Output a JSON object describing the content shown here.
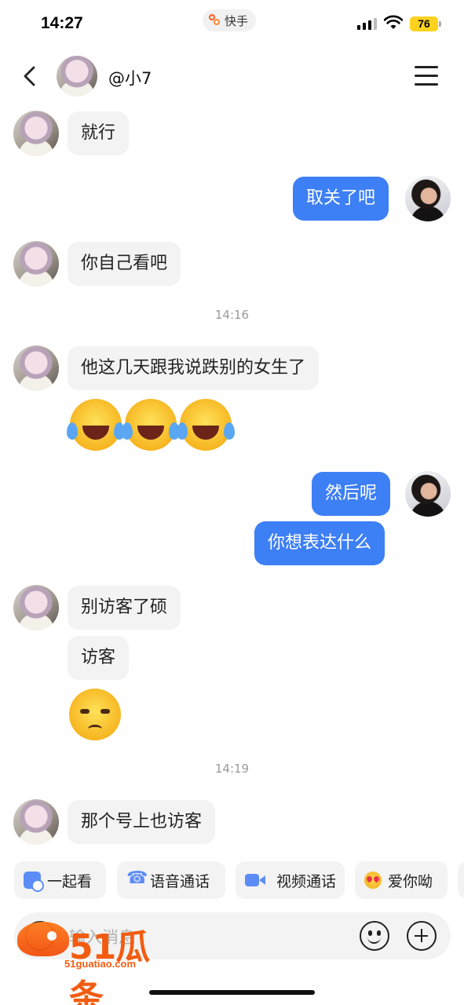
{
  "status_bar": {
    "time": "14:27",
    "app_name": "快手",
    "battery": "76"
  },
  "header": {
    "contact_name": "@小7"
  },
  "messages": [
    {
      "side": "incoming",
      "type": "text",
      "text": "就行"
    },
    {
      "side": "outgoing",
      "type": "text",
      "text": "取关了吧"
    },
    {
      "side": "incoming",
      "type": "text",
      "text": "你自己看吧"
    },
    {
      "type": "timestamp",
      "text": "14:16"
    },
    {
      "side": "incoming",
      "type": "text",
      "text": "他这几天跟我说跌别的女生了"
    },
    {
      "side": "incoming",
      "type": "emoji",
      "emoji": "loudly-crying-laughing",
      "count": 3
    },
    {
      "side": "outgoing",
      "type": "text",
      "text": "然后呢"
    },
    {
      "side": "outgoing",
      "type": "text",
      "text": "你想表达什么"
    },
    {
      "side": "incoming",
      "type": "text",
      "text": "别访客了硕"
    },
    {
      "side": "incoming",
      "type": "text",
      "text": "访客"
    },
    {
      "side": "incoming",
      "type": "emoji",
      "emoji": "unamused-face",
      "count": 1
    },
    {
      "type": "timestamp",
      "text": "14:19"
    },
    {
      "side": "incoming",
      "type": "text",
      "text": "那个号上也访客"
    }
  ],
  "quick_actions": [
    {
      "label": "一起看",
      "icon": "watch-together-icon"
    },
    {
      "label": "语音通话",
      "icon": "phone-icon"
    },
    {
      "label": "视频通话",
      "icon": "video-camera-icon"
    },
    {
      "label": "爱你呦",
      "icon": "heart-eyes-icon"
    }
  ],
  "input": {
    "placeholder": "输入消息"
  },
  "watermark": {
    "brand": "51瓜条",
    "url": "51guatiao.com"
  },
  "colors": {
    "outgoing_bubble": "#3d7ff4",
    "incoming_bubble": "#f3f3f3",
    "accent": "#5c8df6",
    "watermark": "#f25c10"
  }
}
